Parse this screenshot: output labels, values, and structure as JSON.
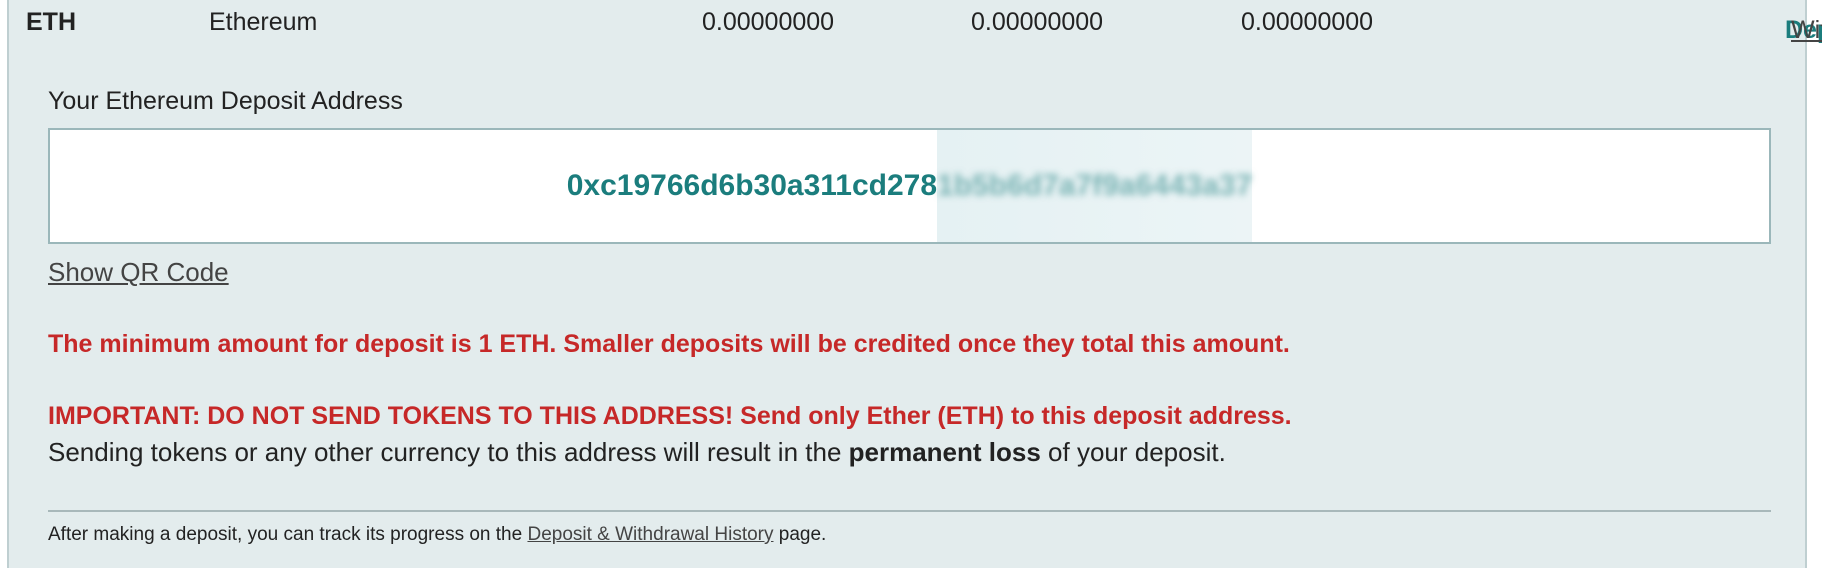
{
  "row": {
    "symbol": "ETH",
    "name": "Ethereum",
    "balance1": "0.00000000",
    "balance2": "0.00000000",
    "balance3": "0.00000000",
    "deposit_label": "Deposit",
    "withdraw_label": "Withdraw"
  },
  "deposit": {
    "address_label": "Your Ethereum Deposit Address",
    "address_visible": "0xc19766d6b30a311cd278",
    "address_hidden": "1b5b6d7a7f9a6443a37",
    "show_qr_label": "Show QR Code",
    "min_warning": "The minimum amount for deposit is 1 ETH. Smaller deposits will be credited once they total this amount.",
    "important_warning": "IMPORTANT: DO NOT SEND TOKENS TO THIS ADDRESS! Send only Ether (ETH) to this deposit address.",
    "note_prefix": "Sending tokens or any other currency to this address will result in the ",
    "note_bold": "permanent loss",
    "note_suffix": " of your deposit.",
    "footer_prefix": "After making a deposit, you can track its progress on the ",
    "footer_link": "Deposit & Withdrawal History",
    "footer_suffix": " page."
  },
  "colors": {
    "accent": "#1b7d7d",
    "warning": "#c62828",
    "panel_bg": "#e3eced"
  }
}
